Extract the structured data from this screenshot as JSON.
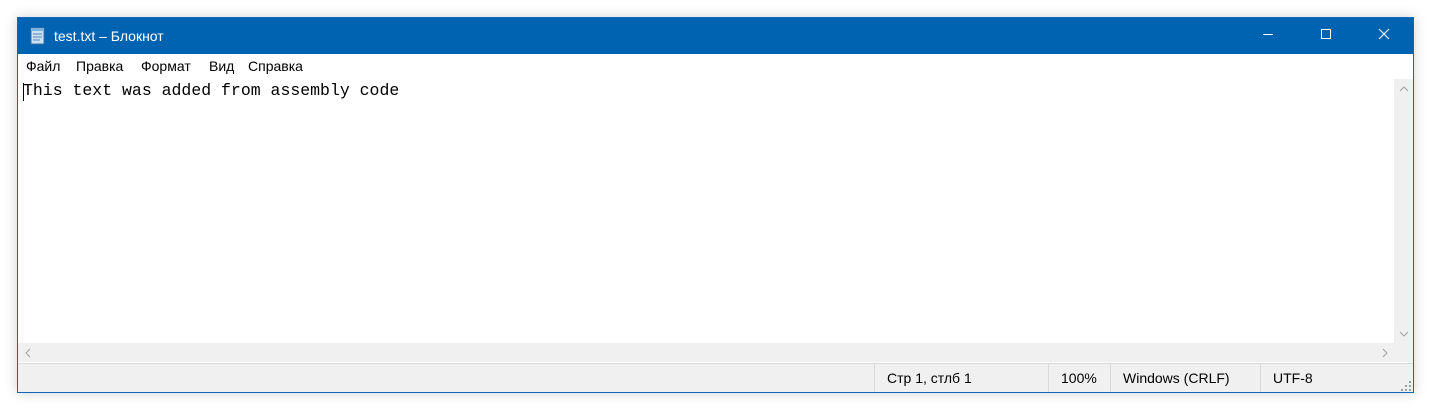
{
  "window": {
    "title": "test.txt – Блокнот",
    "icon": "notepad-icon",
    "controls": {
      "minimize_icon": "minimize-icon",
      "maximize_icon": "maximize-icon",
      "close_icon": "close-icon"
    },
    "titlebar_color": "#0063b1"
  },
  "menu": {
    "items": [
      {
        "label": "Файл"
      },
      {
        "label": "Правка"
      },
      {
        "label": "Формат"
      },
      {
        "label": "Вид"
      },
      {
        "label": "Справка"
      }
    ]
  },
  "editor": {
    "content": "This text was added from assembly code"
  },
  "status": {
    "position": "Стр 1, стлб 1",
    "zoom": "100%",
    "line_ending": "Windows (CRLF)",
    "encoding": "UTF-8"
  }
}
